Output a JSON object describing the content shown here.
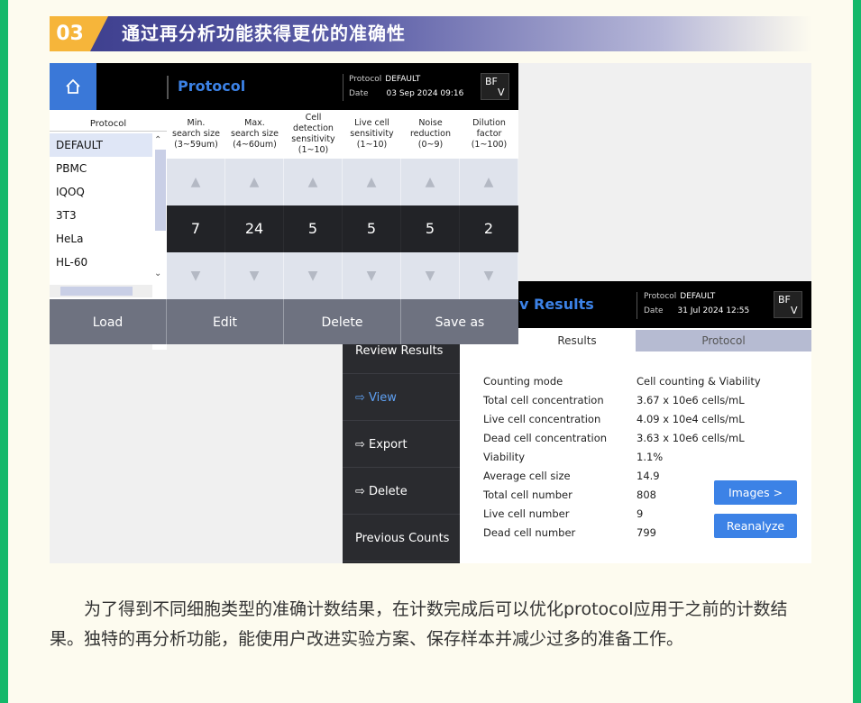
{
  "section": {
    "number": "03",
    "title": "通过再分析功能获得更优的准确性"
  },
  "protocol_window": {
    "home_icon": "home-icon",
    "title": "Protocol",
    "meta": {
      "protocol_label": "Protocol",
      "protocol_value": "DEFAULT",
      "date_label": "Date",
      "date_value": "03 Sep 2024 09:16"
    },
    "bf_label_top": "BF",
    "bf_label_bottom": "V",
    "list_header": "Protocol",
    "list_items": [
      "DEFAULT",
      "PBMC",
      "IQOQ",
      "3T3",
      "HeLa",
      "HL-60"
    ],
    "columns": [
      {
        "l1": "Min.",
        "l2": "search size",
        "l3": "(3~59um)",
        "value": "7"
      },
      {
        "l1": "Max.",
        "l2": "search size",
        "l3": "(4~60um)",
        "value": "24"
      },
      {
        "l1": "Cell",
        "l2": "detection",
        "l3": "sensitivity",
        "l4": "(1~10)",
        "value": "5"
      },
      {
        "l1": "Live cell",
        "l2": "sensitivity",
        "l3": "(1~10)",
        "value": "5"
      },
      {
        "l1": "Noise",
        "l2": "reduction",
        "l3": "(0~9)",
        "value": "5"
      },
      {
        "l1": "Dilution",
        "l2": "factor",
        "l3": "(1~100)",
        "value": "2"
      }
    ],
    "up_arrow": "▲",
    "down_arrow": "▼",
    "buttons": [
      "Load",
      "Edit",
      "Delete",
      "Save as"
    ]
  },
  "results_window": {
    "title": "v Results",
    "meta": {
      "protocol_label": "Protocol",
      "protocol_value": "DEFAULT",
      "date_label": "Date",
      "date_value": "31 Jul 2024 12:55"
    },
    "bf_label_top": "BF",
    "bf_label_bottom": "V",
    "tabs": {
      "results": "Results",
      "protocol": "Protocol"
    },
    "menu": [
      "Review Results",
      "⇨ View",
      "⇨ Export",
      "⇨ Delete",
      "Previous Counts"
    ],
    "rows": [
      {
        "k": "Counting mode",
        "v": "Cell counting & Viability"
      },
      {
        "k": "Total cell concentration",
        "v": "3.67 x 10e6 cells/mL"
      },
      {
        "k": "Live cell concentration",
        "v": "4.09 x 10e4 cells/mL"
      },
      {
        "k": "Dead cell concentration",
        "v": "3.63 x 10e6 cells/mL"
      },
      {
        "k": "Viability",
        "v": "1.1%"
      },
      {
        "k": "Average cell size",
        "v": "14.9"
      },
      {
        "k": "Total cell number",
        "v": "808"
      },
      {
        "k": "Live cell number",
        "v": "9"
      },
      {
        "k": "Dead cell number",
        "v": "799"
      }
    ],
    "images_button": "Images >",
    "reanalyze_button": "Reanalyze"
  },
  "paragraph": "为了得到不同细胞类型的准确计数结果，在计数完成后可以优化protocol应用于之前的计数结果。独特的再分析功能，能使用户改进实验方案、保存样本并减少过多的准备工作。"
}
